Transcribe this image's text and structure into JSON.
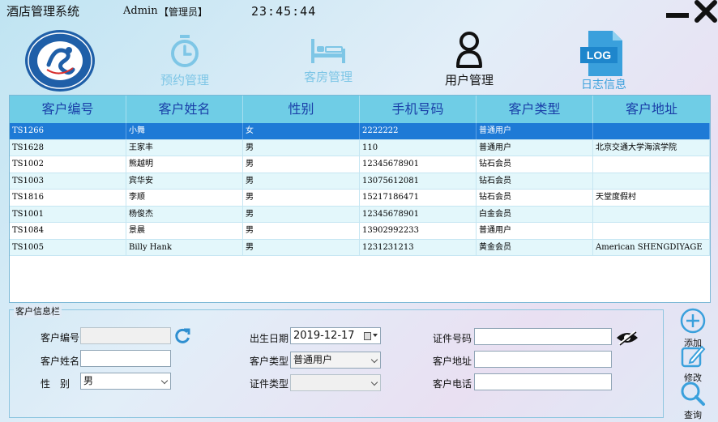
{
  "header": {
    "app_title": "酒店管理系统",
    "user": "Admin",
    "role": "【管理员】",
    "time": "23:45:44"
  },
  "nav": [
    {
      "label": "预约管理",
      "icon": "stopwatch-icon",
      "color": "#7ec6e6"
    },
    {
      "label": "客房管理",
      "icon": "bed-icon",
      "color": "#7ec6e6"
    },
    {
      "label": "用户管理",
      "icon": "user-icon",
      "color": "#111111"
    },
    {
      "label": "日志信息",
      "icon": "log-file-icon",
      "color": "#3aa0dc",
      "badge": "LOG"
    }
  ],
  "table": {
    "columns": [
      "客户编号",
      "客户姓名",
      "性别",
      "手机号码",
      "客户类型",
      "客户地址"
    ],
    "rows": [
      [
        "TS1266",
        "小舞",
        "女",
        "2222222",
        "普通用户",
        ""
      ],
      [
        "TS1628",
        "王家丰",
        "男",
        "110",
        "普通用户",
        "北京交通大学海滨学院"
      ],
      [
        "TS1002",
        "熊越明",
        "男",
        "12345678901",
        "钻石会员",
        ""
      ],
      [
        "TS1003",
        "宾华安",
        "男",
        "13075612081",
        "钻石会员",
        ""
      ],
      [
        "TS1816",
        "李顺",
        "男",
        "15217186471",
        "钻石会员",
        "天堂度假村"
      ],
      [
        "TS1001",
        "杨俊杰",
        "男",
        "12345678901",
        "白金会员",
        ""
      ],
      [
        "TS1084",
        "景晨",
        "男",
        "13902992233",
        "普通用户",
        ""
      ],
      [
        "TS1005",
        "Billy Hank",
        "男",
        "1231231213",
        "黄金会员",
        "American SHENGDIYAGE"
      ]
    ],
    "selected_row": 0
  },
  "form": {
    "legend": "客户信息栏",
    "customer_id_label": "客户编号",
    "customer_id_value": "",
    "name_label": "客户姓名",
    "name_value": "",
    "gender_label": "性　别",
    "gender_value": "男",
    "birth_label": "出生日期",
    "birth_value": "2019-12-17",
    "type_label": "客户类型",
    "type_value": "普通用户",
    "cert_type_label": "证件类型",
    "cert_type_value": "",
    "cert_no_label": "证件号码",
    "cert_no_value": "",
    "address_label": "客户地址",
    "address_value": "",
    "phone_label": "客户电话",
    "phone_value": ""
  },
  "actions": {
    "add": "添加",
    "edit": "修改",
    "query": "查询"
  },
  "colors": {
    "header_bg": "#6fcde6",
    "header_text": "#1a3fa8",
    "selected_row": "#1e7ad6",
    "accent": "#3aa0dc"
  }
}
